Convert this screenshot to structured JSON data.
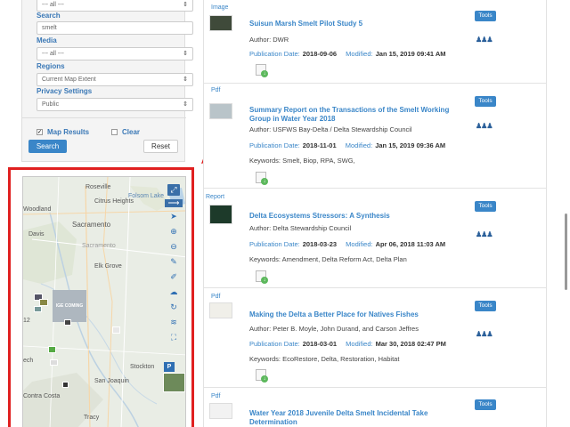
{
  "filters": {
    "top_select": "--- all ---",
    "search_label": "Search",
    "search_value": "smelt",
    "media_label": "Media",
    "media_value": "--- all ---",
    "regions_label": "Regions",
    "regions_value": "Current Map Extent",
    "privacy_label": "Privacy Settings",
    "privacy_value": "Public",
    "map_results_label": "Map Results",
    "clear_label": "Clear",
    "search_button": "Search",
    "reset_button": "Reset"
  },
  "map": {
    "places": [
      "Roseville",
      "Citrus Heights",
      "Folsom Lake",
      "Woodland",
      "Sacramento",
      "Davis",
      "Sacramento",
      "Elk Grove",
      "Stockton",
      "San Joaquin",
      "Tracy",
      "Contra Costa",
      "ech",
      "12"
    ],
    "coming_soon": "IGE COMING SC",
    "p_badge": "P"
  },
  "results": [
    {
      "type": "Image",
      "title": "Suisun Marsh Smelt Pilot Study 5",
      "author": "Author: DWR",
      "pub_label": "Publication Date:",
      "pub_value": "2018-09-06",
      "mod_label": "Modified:",
      "mod_value": "Jan 15, 2019 09:41 AM",
      "keywords": "",
      "tools": "Tools"
    },
    {
      "type": "Pdf",
      "title": "Summary Report on the Transactions of the Smelt Working Group in Water Year 2018",
      "author": "Author: USFWS Bay-Delta / Delta Stewardship Council",
      "pub_label": "Publication Date:",
      "pub_value": "2018-11-01",
      "mod_label": "Modified:",
      "mod_value": "Jan 15, 2019 09:36 AM",
      "keywords": "Keywords: Smelt, Biop, RPA, SWG,",
      "tools": "Tools"
    },
    {
      "type": "Report",
      "title": "Delta Ecosystems Stressors: A Synthesis",
      "author": "Author: Delta Stewardship Council",
      "pub_label": "Publication Date:",
      "pub_value": "2018-03-23",
      "mod_label": "Modified:",
      "mod_value": "Apr 06, 2018 11:03 AM",
      "keywords": "Keywords: Amendment, Delta Reform Act, Delta Plan",
      "tools": "Tools"
    },
    {
      "type": "Pdf",
      "title": "Making the Delta a Better Place for Natives Fishes",
      "author": "Author: Peter B. Moyle, John Durand, and Carson Jeffres",
      "pub_label": "Publication Date:",
      "pub_value": "2018-03-01",
      "mod_label": "Modified:",
      "mod_value": "Mar 30, 2018 02:47 PM",
      "keywords": "Keywords: EcoRestore, Delta, Restoration, Habitat",
      "tools": "Tools"
    },
    {
      "type": "Pdf",
      "title": "Water Year 2018 Juvenile Delta Smelt Incidental Take Determination",
      "author": "",
      "pub_label": "",
      "pub_value": "",
      "mod_label": "",
      "mod_value": "",
      "keywords": "",
      "tools": "Tools"
    }
  ]
}
